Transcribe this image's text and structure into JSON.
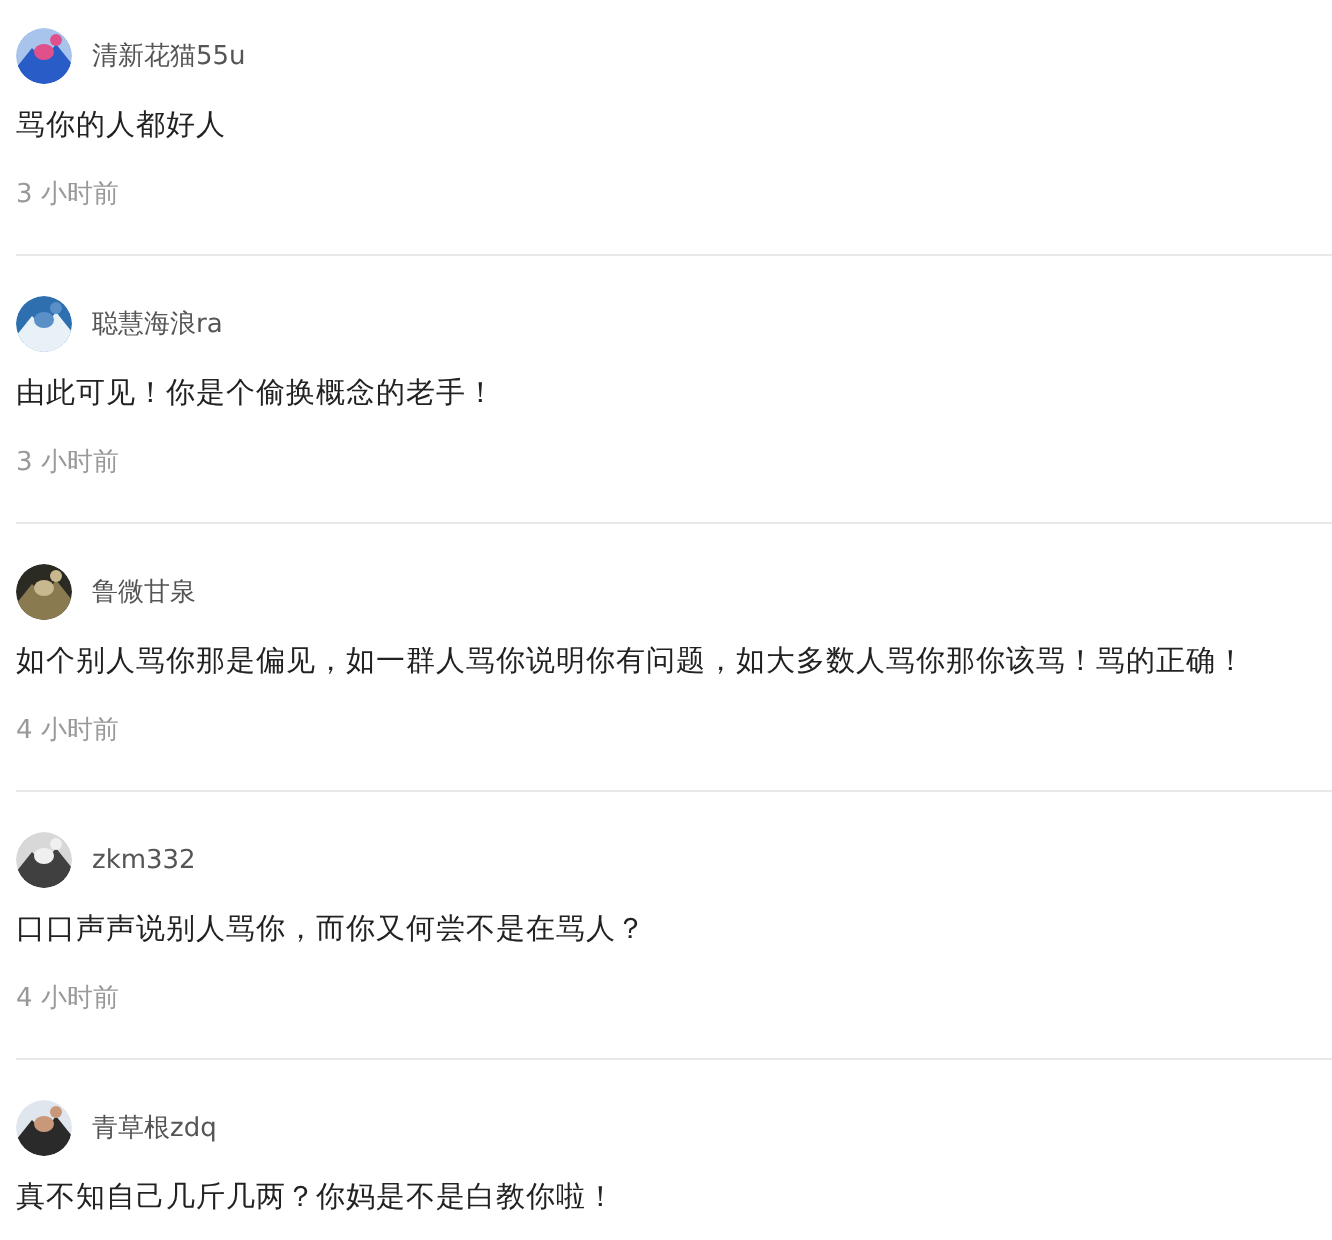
{
  "comments": [
    {
      "user": "清新花猫55u",
      "text": "骂你的人都好人",
      "time": "3 小时前"
    },
    {
      "user": "聪慧海浪ra",
      "text": "由此可见！你是个偷换概念的老手！",
      "time": "3 小时前"
    },
    {
      "user": "鲁微甘泉",
      "text": "如个别人骂你那是偏见，如一群人骂你说明你有问题，如大多数人骂你那你该骂！骂的正确！",
      "time": "4 小时前"
    },
    {
      "user": "zkm332",
      "text": "口口声声说别人骂你，而你又何尝不是在骂人？",
      "time": "4 小时前"
    },
    {
      "user": "青草根zdq",
      "text": "真不知自己几斤几两？你妈是不是白教你啦！"
    }
  ]
}
